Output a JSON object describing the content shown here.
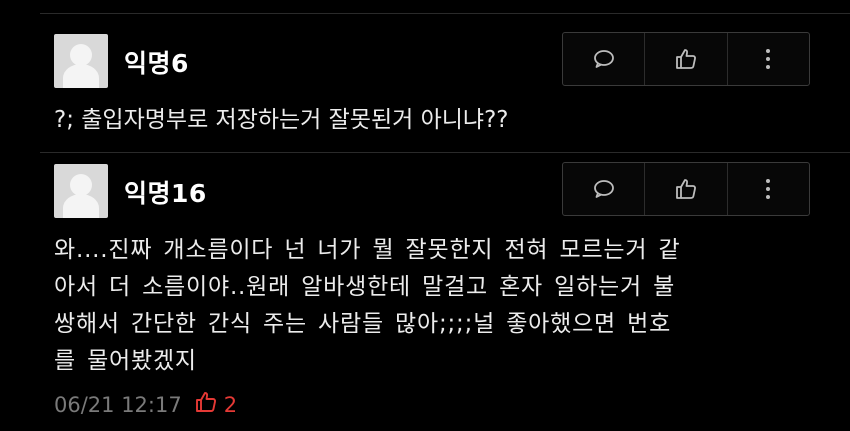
{
  "comments": [
    {
      "author": "익명6",
      "text": "?; 출입자명부로 저장하는거 잘못된거 아니냐??"
    },
    {
      "author": "익명16",
      "text": "와....진짜 개소름이다 넌 너가 뭘 잘못한지 전혀 모르는거 같\n아서 더 소름이야..원래 알바생한테 말걸고 혼자 일하는거 불\n쌍해서 간단한 간식 주는 사람들 많아;;;;널 좋아했으면 번호\n를 물어봤겠지",
      "date": "06/21 12:17",
      "likes": "2"
    }
  ],
  "icons": {
    "reply": "speech-bubble-icon",
    "like": "thumbs-up-icon",
    "more": "more-vertical-icon"
  },
  "colors": {
    "background": "#000000",
    "text": "#ececec",
    "meta": "#7a7a7a",
    "like": "#e53935"
  }
}
